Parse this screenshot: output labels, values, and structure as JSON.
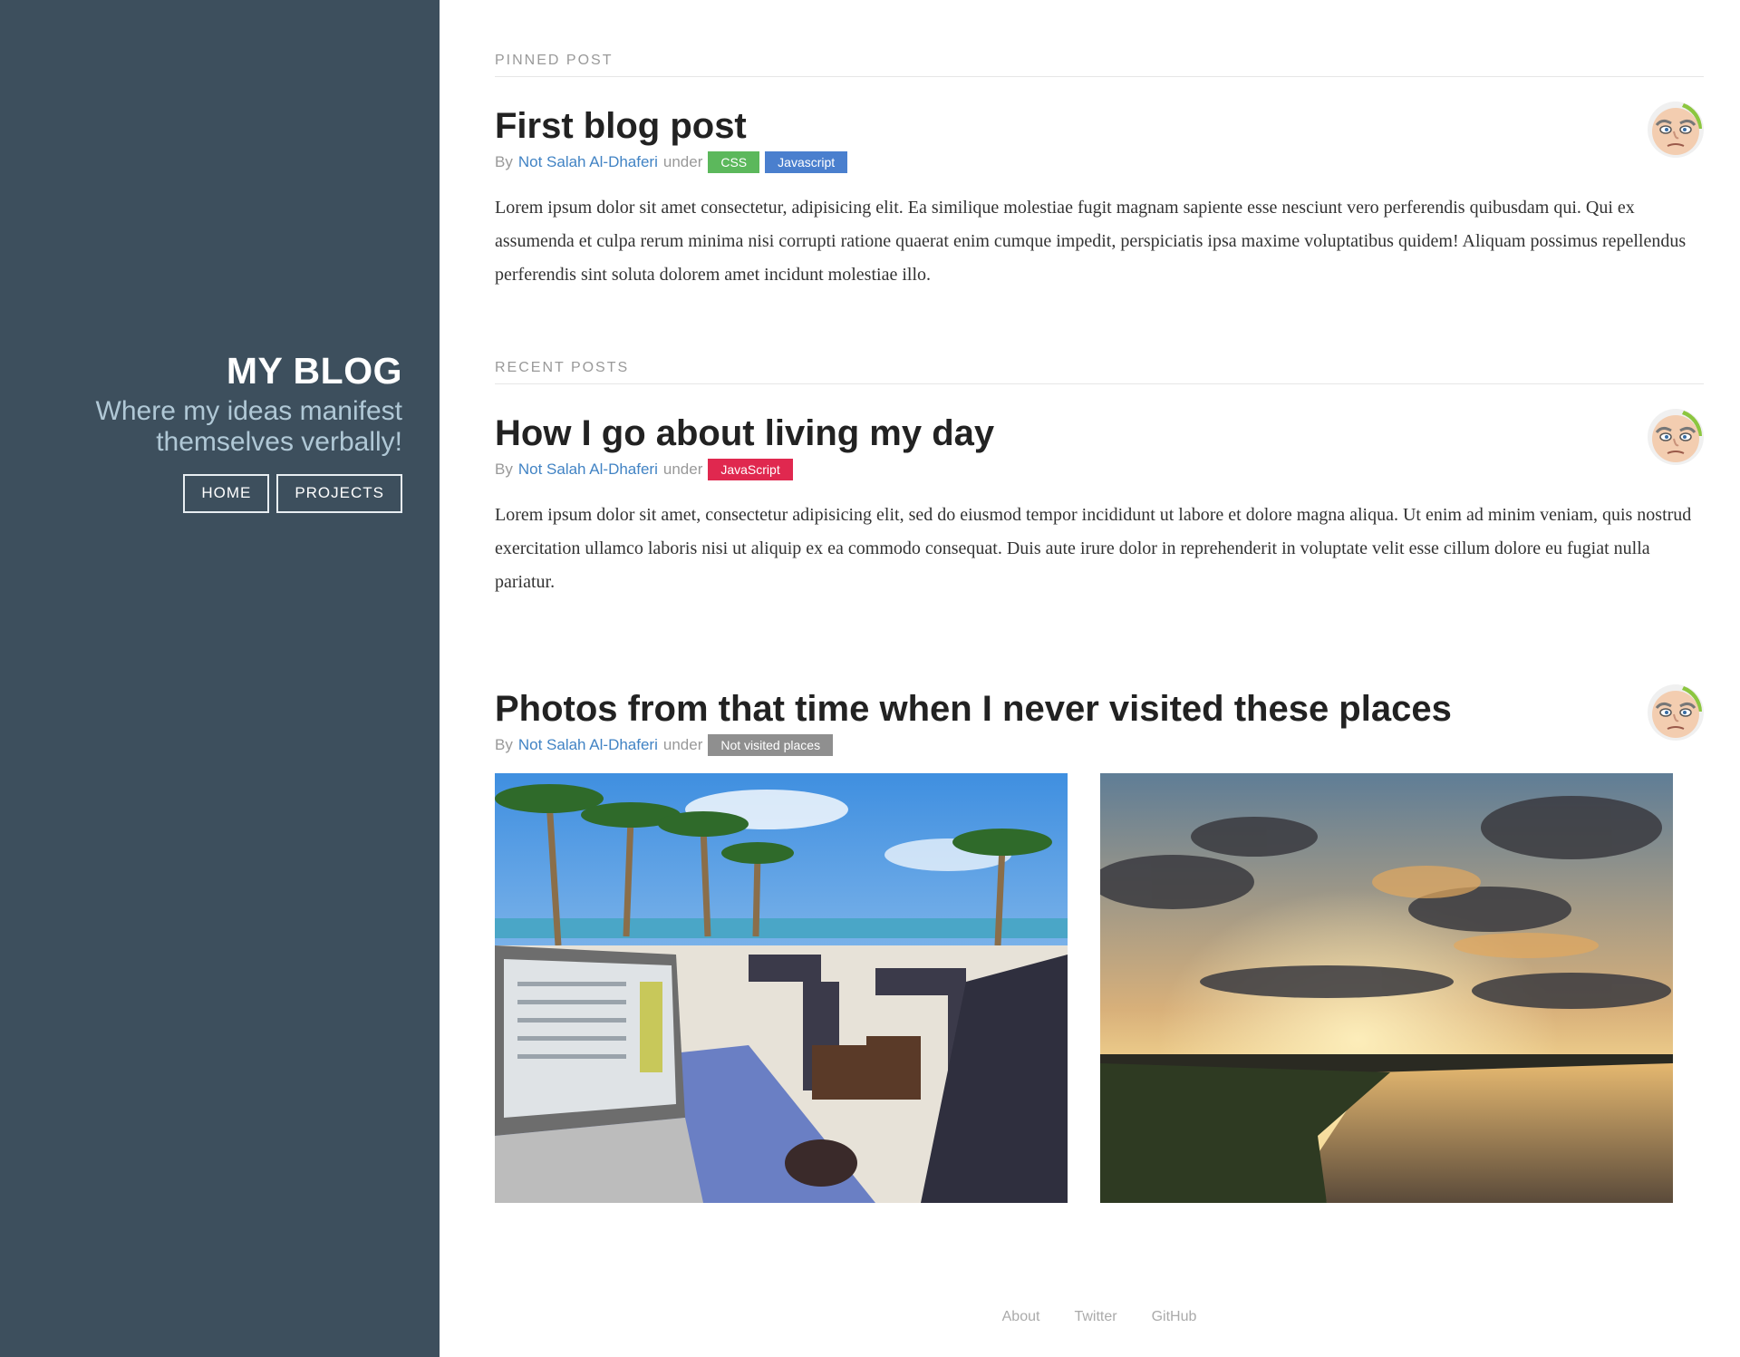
{
  "sidebar": {
    "title": "MY BLOG",
    "tagline_line1": "Where my ideas manifest",
    "tagline_line2": "themselves verbally!",
    "nav": [
      {
        "label": "HOME"
      },
      {
        "label": "PROJECTS"
      }
    ],
    "background": "#3d4f5d"
  },
  "pinned": {
    "section_label": "PINNED POST",
    "post": {
      "title": "First blog post",
      "by": "By",
      "author": "Not Salah Al-Dhaferi",
      "under": "under",
      "tags": [
        {
          "label": "CSS",
          "color": "#5cb85c"
        },
        {
          "label": "Javascript",
          "color": "#4a7fce"
        }
      ],
      "body": "Lorem ipsum dolor sit amet consectetur, adipisicing elit. Ea similique molestiae fugit magnam sapiente esse nesciunt vero perferendis quibusdam qui. Qui ex assumenda et culpa rerum minima nisi corrupti ratione quaerat enim cumque impedit, perspiciatis ipsa maxime voluptatibus quidem! Aliquam possimus repellendus perferendis sint soluta dolorem amet incidunt molestiae illo."
    }
  },
  "recent": {
    "section_label": "RECENT POSTS",
    "posts": [
      {
        "title": "How I go about living my day",
        "by": "By",
        "author": "Not Salah Al-Dhaferi",
        "under": "under",
        "tags": [
          {
            "label": "JavaScript",
            "color": "#e0284f"
          }
        ],
        "body": "Lorem ipsum dolor sit amet, consectetur adipisicing elit, sed do eiusmod tempor incididunt ut labore et dolore magna aliqua. Ut enim ad minim veniam, quis nostrud exercitation ullamco laboris nisi ut aliquip ex ea commodo consequat. Duis aute irure dolor in reprehenderit in voluptate velit esse cillum dolore eu fugiat nulla pariatur."
      },
      {
        "title": "Photos from that time when I never visited these places",
        "by": "By",
        "author": "Not Salah Al-Dhaferi",
        "under": "under",
        "tags": [
          {
            "label": "Not visited places",
            "color": "#8f8f8f"
          }
        ],
        "photos": [
          "patio-cafe-photo",
          "sunset-marsh-photo"
        ]
      }
    ]
  },
  "footer": {
    "links": [
      {
        "label": "About"
      },
      {
        "label": "Twitter"
      },
      {
        "label": "GitHub"
      }
    ]
  },
  "colors": {
    "link": "#4183c4",
    "tagline": "#b0c8d6"
  }
}
